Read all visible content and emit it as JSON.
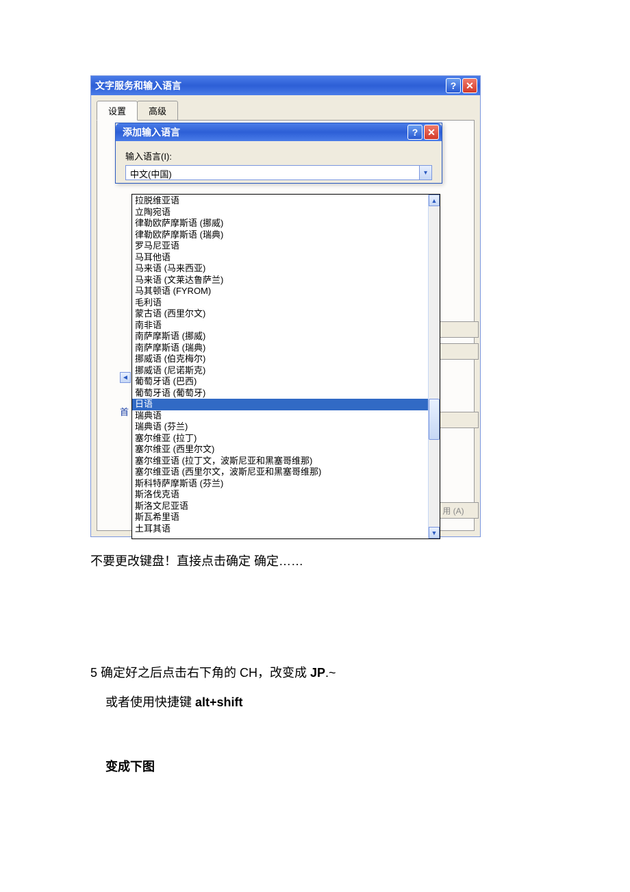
{
  "outer_window": {
    "title": "文字服务和输入语言",
    "tabs": [
      "设置",
      "高级"
    ]
  },
  "inner_dialog": {
    "title": "添加输入语言",
    "field_label": "输入语言(I):",
    "combo_value": "中文(中国)"
  },
  "dropdown": {
    "selected_index": 18,
    "items": [
      "拉脱维亚语",
      "立陶宛语",
      "律勒欧萨摩斯语 (挪威)",
      "律勒欧萨摩斯语 (瑞典)",
      "罗马尼亚语",
      "马耳他语",
      "马来语 (马来西亚)",
      "马来语 (文莱达鲁萨兰)",
      "马其顿语 (FYROM)",
      "毛利语",
      "蒙古语 (西里尔文)",
      "南非语",
      "南萨摩斯语 (挪威)",
      "南萨摩斯语 (瑞典)",
      "挪威语 (伯克梅尔)",
      "挪威语 (尼诺斯克)",
      "葡萄牙语 (巴西)",
      "葡萄牙语 (葡萄牙)",
      "日语",
      "瑞典语",
      "瑞典语 (芬兰)",
      "塞尔维亚 (拉丁)",
      "塞尔维亚 (西里尔文)",
      "塞尔维亚语 (拉丁文，波斯尼亚和黑塞哥维那)",
      "塞尔维亚语 (西里尔文，波斯尼亚和黑塞哥维那)",
      "斯科特萨摩斯语 (芬兰)",
      "斯洛伐克语",
      "斯洛文尼亚语",
      "斯瓦希里语",
      "土耳其语"
    ]
  },
  "peek": {
    "label": "首",
    "btn_text": "用 (A)"
  },
  "doc": {
    "line1": "不要更改键盘！直接点击确定  确定……",
    "step5_a": "5  确定好之后点击右下角的 CH，改变成 ",
    "step5_b": "JP",
    "step5_c": ".~",
    "shortcut_a": "或者使用快捷键  ",
    "shortcut_b": "alt+shift",
    "line_final": "变成下图"
  }
}
